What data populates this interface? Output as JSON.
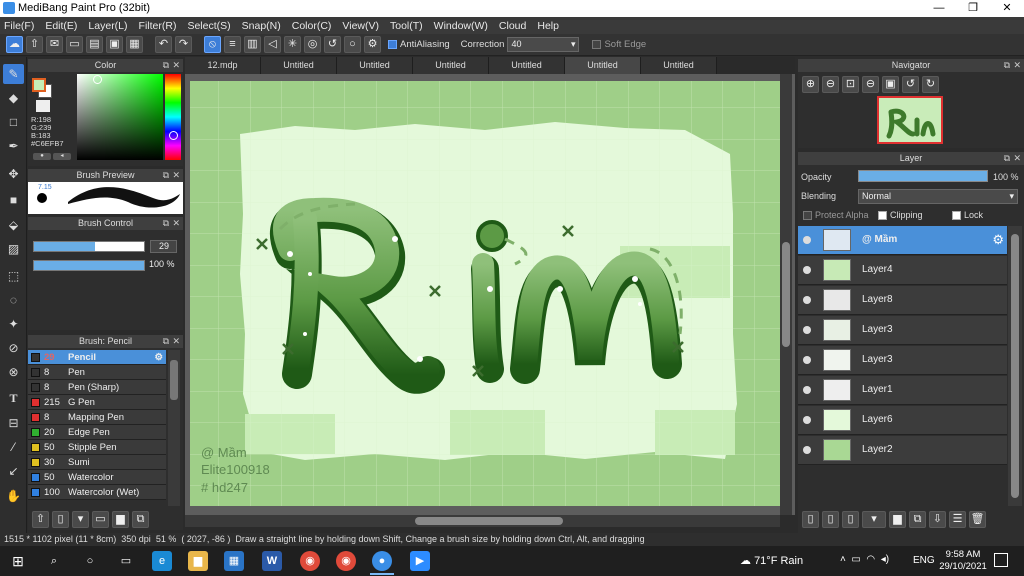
{
  "app": {
    "title": "MediBang Paint Pro (32bit)"
  },
  "window": {
    "minimize": "—",
    "restore": "❐",
    "close": "✕"
  },
  "menu": [
    "File(F)",
    "Edit(E)",
    "Layer(L)",
    "Filter(R)",
    "Select(S)",
    "Snap(N)",
    "Color(C)",
    "View(V)",
    "Tool(T)",
    "Window(W)",
    "Cloud",
    "Help"
  ],
  "toolbar": {
    "antialiasing_label": "AntiAliasing",
    "correction_label": "Correction",
    "correction_value": "40",
    "soft_edge_label": "Soft Edge"
  },
  "color_panel": {
    "title": "Color",
    "r": "R:198",
    "g": "G:239",
    "b": "B:183",
    "hex": "#C6EFB7",
    "fg_color": "#c6efb7",
    "bg_color": "#ffffff"
  },
  "brush_preview": {
    "title": "Brush Preview",
    "size_text": "7.15"
  },
  "brush_control": {
    "title": "Brush Control",
    "size": "29",
    "opacity": "100 %"
  },
  "brush_list": {
    "title": "Brush: Pencil",
    "items": [
      {
        "size": "29",
        "name": "Pencil",
        "color": "#333333"
      },
      {
        "size": "8",
        "name": "Pen",
        "color": "#333333"
      },
      {
        "size": "8",
        "name": "Pen (Sharp)",
        "color": "#333333"
      },
      {
        "size": "215",
        "name": "G Pen",
        "color": "#e03030"
      },
      {
        "size": "8",
        "name": "Mapping Pen",
        "color": "#e03030"
      },
      {
        "size": "20",
        "name": "Edge Pen",
        "color": "#30b030"
      },
      {
        "size": "50",
        "name": "Stipple Pen",
        "color": "#e0c020"
      },
      {
        "size": "30",
        "name": "Sumi",
        "color": "#e0c020"
      },
      {
        "size": "50",
        "name": "Watercolor",
        "color": "#3080e0"
      },
      {
        "size": "100",
        "name": "Watercolor (Wet)",
        "color": "#3080e0"
      }
    ]
  },
  "tabs": [
    "12.mdp",
    "Untitled",
    "Untitled",
    "Untitled",
    "Untitled",
    "Untitled",
    "Untitled"
  ],
  "canvas": {
    "lettering": "Rin",
    "watermark": [
      "@ Mầm",
      "Elite100918",
      "# hd247"
    ]
  },
  "navigator": {
    "title": "Navigator"
  },
  "layer_panel": {
    "title": "Layer",
    "opacity_label": "Opacity",
    "opacity_value": "100 %",
    "blending_label": "Blending",
    "blending_value": "Normal",
    "protect_alpha": "Protect Alpha",
    "clipping": "Clipping",
    "lock": "Lock",
    "layers": [
      {
        "name": "@ Mầm"
      },
      {
        "name": "Layer4"
      },
      {
        "name": "Layer8"
      },
      {
        "name": "Layer3"
      },
      {
        "name": "Layer3"
      },
      {
        "name": "Layer1"
      },
      {
        "name": "Layer6"
      },
      {
        "name": "Layer2"
      }
    ]
  },
  "status": {
    "dimensions": "1515 * 1102 pixel",
    "size_cm": "(11 * 8cm)",
    "dpi": "350 dpi",
    "zoom": "51 %",
    "coords": "( 2027, -86 )",
    "hint": "Draw a straight line by holding down Shift, Change a brush size by holding down Ctrl, Alt, and dragging"
  },
  "taskbar": {
    "weather": "71°F  Rain",
    "lang": "ENG",
    "time": "9:58 AM",
    "date": "29/10/2021"
  }
}
